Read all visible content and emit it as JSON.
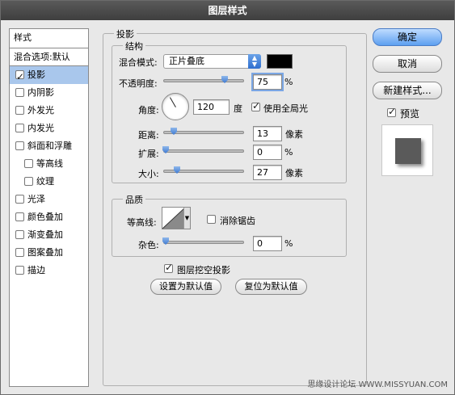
{
  "window": {
    "title": "图层样式"
  },
  "sidebar": {
    "header": "样式",
    "blend_options": "混合选项:默认",
    "items": [
      {
        "label": "投影",
        "checked": true,
        "selected": true
      },
      {
        "label": "内阴影",
        "checked": false
      },
      {
        "label": "外发光",
        "checked": false
      },
      {
        "label": "内发光",
        "checked": false
      },
      {
        "label": "斜面和浮雕",
        "checked": false
      },
      {
        "label": "等高线",
        "checked": false,
        "sub": true
      },
      {
        "label": "纹理",
        "checked": false,
        "sub": true
      },
      {
        "label": "光泽",
        "checked": false
      },
      {
        "label": "颜色叠加",
        "checked": false
      },
      {
        "label": "渐变叠加",
        "checked": false
      },
      {
        "label": "图案叠加",
        "checked": false
      },
      {
        "label": "描边",
        "checked": false
      }
    ]
  },
  "drop_shadow": {
    "title": "投影",
    "structure": {
      "title": "结构",
      "blend_mode_label": "混合模式:",
      "blend_mode_value": "正片叠底",
      "shadow_color": "#000000",
      "opacity_label": "不透明度:",
      "opacity_value": "75",
      "opacity_unit": "%",
      "angle_label": "角度:",
      "angle_value": "120",
      "angle_unit": "度",
      "global_light_label": "使用全局光",
      "global_light_checked": true,
      "distance_label": "距离:",
      "distance_value": "13",
      "distance_unit": "像素",
      "spread_label": "扩展:",
      "spread_value": "0",
      "spread_unit": "%",
      "size_label": "大小:",
      "size_value": "27",
      "size_unit": "像素"
    },
    "quality": {
      "title": "品质",
      "contour_label": "等高线:",
      "anti_alias_label": "消除锯齿",
      "anti_alias_checked": false,
      "noise_label": "杂色:",
      "noise_value": "0",
      "noise_unit": "%"
    },
    "knockout_label": "图层挖空投影",
    "knockout_checked": true,
    "set_default_button": "设置为默认值",
    "reset_default_button": "复位为默认值"
  },
  "buttons": {
    "ok": "确定",
    "cancel": "取消",
    "new_style": "新建样式...",
    "preview_label": "预览",
    "preview_checked": true
  },
  "watermark": "思缘设计论坛 WWW.MISSYUAN.COM"
}
